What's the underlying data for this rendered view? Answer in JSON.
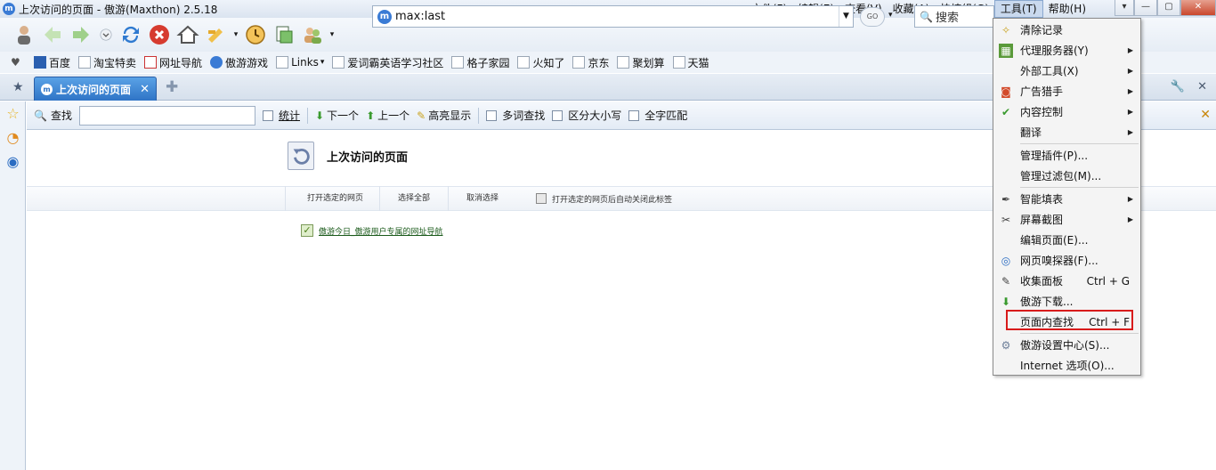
{
  "window": {
    "title": "上次访问的页面 - 傲游(Maxthon) 2.5.18"
  },
  "menubar": [
    {
      "label": "文件(F)"
    },
    {
      "label": "编辑(E)"
    },
    {
      "label": "查看(V)"
    },
    {
      "label": "收藏(A)"
    },
    {
      "label": "快捷组(G)"
    },
    {
      "label": "工具(T)"
    },
    {
      "label": "帮助(H)"
    }
  ],
  "address": {
    "url": "max:last",
    "go": "GO"
  },
  "search": {
    "placeholder": "搜索"
  },
  "bookmarks": [
    "百度",
    "淘宝特卖",
    "网址导航",
    "傲游游戏",
    "Links",
    "爱词霸英语学习社区",
    "格子家园",
    "火知了",
    "京东",
    "聚划算",
    "天猫"
  ],
  "tab": {
    "label": "上次访问的页面"
  },
  "findbar": {
    "find_label": "查找",
    "count_label": "统计",
    "next_label": "下一个",
    "prev_label": "上一个",
    "highlight_label": "高亮显示",
    "multi_label": "多词查找",
    "case_label": "区分大小写",
    "whole_label": "全字匹配"
  },
  "content": {
    "page_title": "上次访问的页面",
    "open_selected": "打开选定的网页",
    "select_all": "选择全部",
    "deselect": "取消选择",
    "auto_close": "打开选定的网页后自动关闭此标签",
    "entry": "傲游今日_傲游用户专属的网址导航"
  },
  "tools_menu": [
    {
      "label": "清除记录"
    },
    {
      "label": "代理服务器(Y)"
    },
    {
      "label": "外部工具(X)"
    },
    {
      "label": "广告猎手"
    },
    {
      "label": "内容控制"
    },
    {
      "label": "翻译"
    },
    {
      "label": "管理插件(P)..."
    },
    {
      "label": "管理过滤包(M)..."
    },
    {
      "label": "智能填表"
    },
    {
      "label": "屏幕截图"
    },
    {
      "label": "编辑页面(E)..."
    },
    {
      "label": "网页嗅探器(F)..."
    },
    {
      "label": "收集面板",
      "shortcut": "Ctrl + G"
    },
    {
      "label": "傲游下载..."
    },
    {
      "label": "页面内查找",
      "shortcut": "Ctrl + F"
    },
    {
      "label": "傲游设置中心(S)..."
    },
    {
      "label": "Internet 选项(O)..."
    }
  ],
  "icons": {
    "tools": [
      "user-icon",
      "back-icon",
      "forward-icon",
      "history-dropdown-icon",
      "refresh-icon",
      "stop-icon",
      "home-icon",
      "bookmark-icon",
      "clock-icon",
      "screenshot-icon",
      "friends-icon"
    ]
  }
}
